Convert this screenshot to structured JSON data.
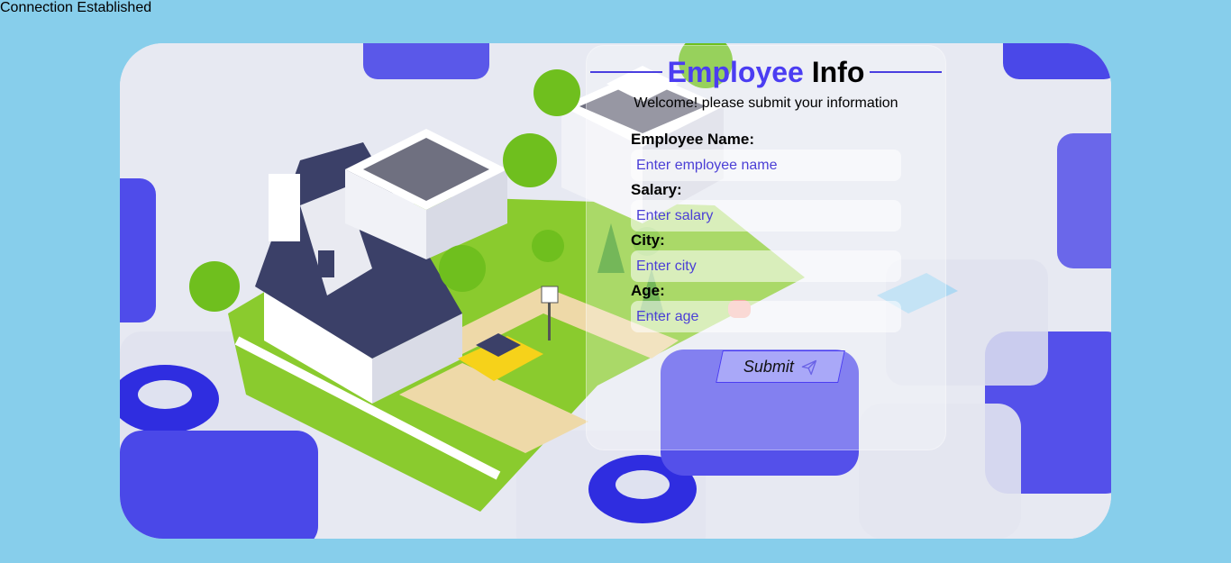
{
  "status": {
    "text": "Connection Established"
  },
  "form": {
    "title_accent": "Employee",
    "title_rest": "Info",
    "subtitle": "Welcome! please submit your information",
    "fields": [
      {
        "label": "Employee Name:",
        "placeholder": "Enter employee name",
        "value": ""
      },
      {
        "label": "Salary:",
        "placeholder": "Enter salary",
        "value": ""
      },
      {
        "label": "City:",
        "placeholder": "Enter city",
        "value": ""
      },
      {
        "label": "Age:",
        "placeholder": "Enter age",
        "value": ""
      }
    ],
    "submit_label": "Submit",
    "submit_icon": "paper-plane-icon"
  },
  "colors": {
    "page_background": "#87CEEB",
    "accent": "#4B3DF2",
    "blue_blocks": "#4A48E8",
    "grass": "#8ACB2E",
    "path": "#EED9A8"
  }
}
